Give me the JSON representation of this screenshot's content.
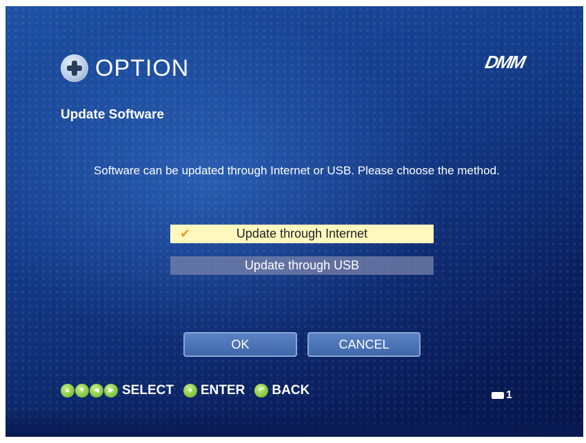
{
  "header": {
    "title": "OPTION",
    "icon": "option-cross-icon",
    "brand": "DMM"
  },
  "section": {
    "title": "Update Software"
  },
  "message": {
    "text": "Software can be updated through Internet or USB. Please choose the method."
  },
  "choices": [
    {
      "label": "Update through Internet",
      "selected": true
    },
    {
      "label": "Update through USB",
      "selected": false
    }
  ],
  "buttons": {
    "ok_label": "OK",
    "cancel_label": "CANCEL"
  },
  "footer": {
    "select_label": "SELECT",
    "enter_label": "ENTER",
    "back_label": "BACK",
    "page_number": "1"
  },
  "colors": {
    "background_top": "#1f55a8",
    "background_bottom": "#06154a",
    "selected_bg": "#fff8bf",
    "check_color": "#f29a1a",
    "button_green": "#7cc13a"
  }
}
